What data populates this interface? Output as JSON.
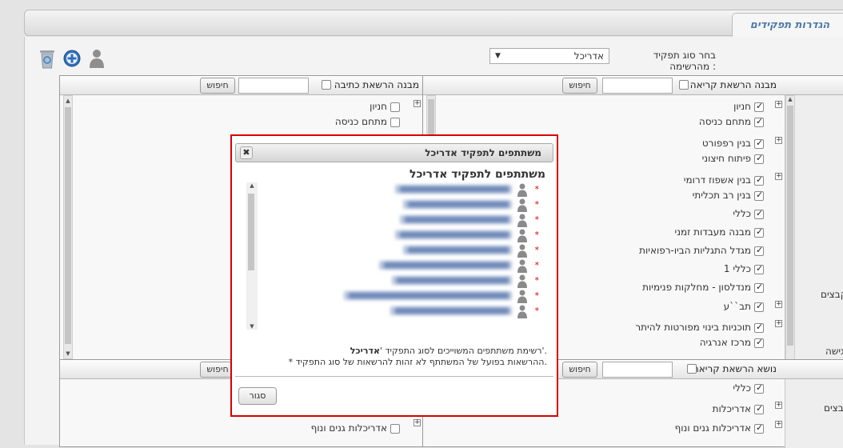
{
  "header": {
    "tab_label": "הגדרות תפקידים"
  },
  "toolbar": {
    "icons": [
      "recycle-bin-icon",
      "add-circle-icon",
      "person-icon"
    ]
  },
  "role_select": {
    "label": "בחר סוג תפקיד מהרשימה :",
    "value": "אדריכל"
  },
  "read_panel": {
    "title": "מבנה הרשאת קריאה",
    "search_label": "חיפוש",
    "items": [
      {
        "label": "חניון",
        "checked": true
      },
      {
        "label": "מתחם כניסה",
        "checked": true
      },
      {
        "label": "בנין רפפורט",
        "checked": true
      },
      {
        "label": "פיתוח חיצוני",
        "checked": true
      },
      {
        "label": "בנין אשפוז דרומי",
        "checked": true
      },
      {
        "label": "בנין רב תכליתי",
        "checked": true
      },
      {
        "label": "כללי",
        "checked": true
      },
      {
        "label": "מבנה מעבדות זמני",
        "checked": true
      },
      {
        "label": "מגדל התגליות הביו-רפואיות",
        "checked": true
      },
      {
        "label": "כללי 1",
        "checked": true
      },
      {
        "label": "מנדלסון - מחלקות פנימיות",
        "checked": true
      },
      {
        "label": "תב``ע",
        "checked": true
      },
      {
        "label": "תוכניות בינוי מפורטות להיתר",
        "checked": true
      },
      {
        "label": "מרכז אנרגיה",
        "checked": true
      }
    ]
  },
  "write_panel": {
    "title": "מבנה הרשאת כתיבה",
    "search_label": "חיפוש",
    "items": [
      {
        "label": "חניון",
        "checked": false
      },
      {
        "label": "מתחם כניסה",
        "checked": false
      }
    ]
  },
  "subject_read_panel": {
    "title": "נושא הרשאת קריאה",
    "search_label": "חיפוש",
    "items": [
      {
        "label": "כללי",
        "checked": true
      },
      {
        "label": "אדריכלות",
        "checked": true
      },
      {
        "label": "אדריכלות גנים ונוף",
        "checked": true
      }
    ]
  },
  "subject_write_panel": {
    "search_label": "חיפוש",
    "items": [
      {
        "label": "אדריכלות גנים ונוף",
        "checked": false
      }
    ]
  },
  "side_fragments": [
    "קבצים",
    "גישה",
    "בצים"
  ],
  "dialog": {
    "title": "משתתפים לתפקיד אדריכל",
    "heading": "משתתפים לתפקיד אדריכל",
    "participant_count": 9,
    "note_line1_prefix": "רשימת משתתפים המשוייכים לסוג התפקיד '",
    "note_line1_role": "אדריכל",
    "note_line1_suffix": "'.",
    "note_line2": "* ההרשאות בפועל של המשתתף לא זהות להרשאות של סוג התפקיד.",
    "close_label": "סגור"
  },
  "colors": {
    "accent": "#4d7aa8",
    "dialog_border": "#d80000",
    "required_star": "#d00000"
  }
}
